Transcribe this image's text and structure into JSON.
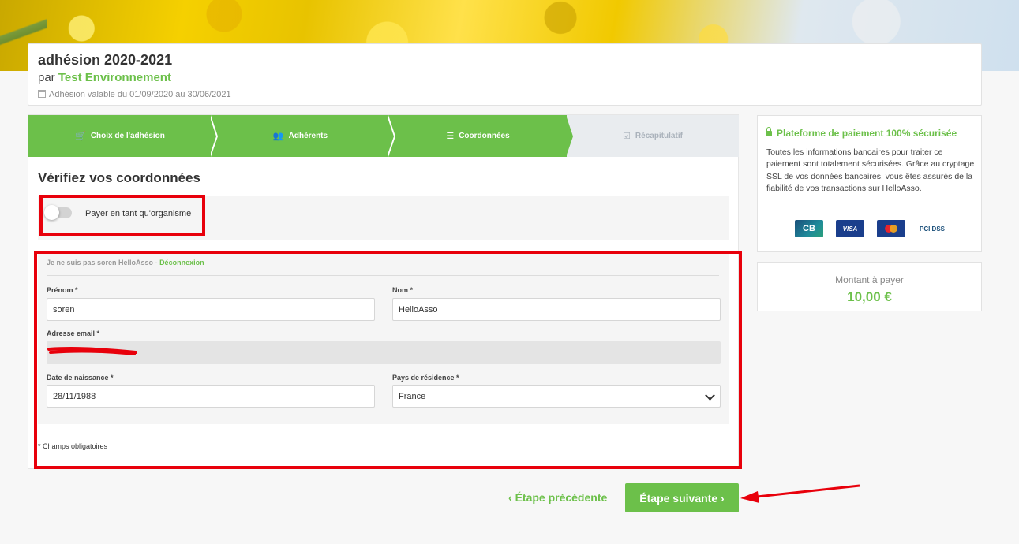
{
  "header": {
    "title": "adhésion 2020-2021",
    "by_prefix": "par",
    "organization": "Test Environnement",
    "validity": "Adhésion valable du 01/09/2020 au 30/06/2021"
  },
  "steps": [
    {
      "label": "Choix de l'adhésion",
      "icon": "cart-icon",
      "state": "done"
    },
    {
      "label": "Adhérents",
      "icon": "users-icon",
      "state": "done"
    },
    {
      "label": "Coordonnées",
      "icon": "list-icon",
      "state": "done"
    },
    {
      "label": "Récapitulatif",
      "icon": "check-square-icon",
      "state": "todo"
    }
  ],
  "form": {
    "section_title": "Vérifiez vos coordonnées",
    "org_toggle_label": "Payer en tant qu'organisme",
    "org_toggle_on": false,
    "not_me_text": "Je ne suis pas soren HelloAsso - ",
    "logout_link": "Déconnexion",
    "first_name_label": "Prénom *",
    "first_name_value": "soren",
    "last_name_label": "Nom *",
    "last_name_value": "HelloAsso",
    "email_label": "Adresse email *",
    "email_value": "",
    "birthdate_label": "Date de naissance *",
    "birthdate_value": "28/11/1988",
    "country_label": "Pays de résidence *",
    "country_value": "France",
    "required_note": "* Champs obligatoires"
  },
  "secure": {
    "title": "Plateforme de paiement 100% sécurisée",
    "text": "Toutes les informations bancaires pour traiter ce paiement sont totalement sécurisées. Grâce au cryptage SSL de vos données bancaires, vous êtes assurés de la fiabilité de vos transactions sur HelloAsso.",
    "cards": [
      {
        "name": "cb-card-icon",
        "text": "CB"
      },
      {
        "name": "visa-card-icon",
        "text": "VISA"
      },
      {
        "name": "mastercard-card-icon",
        "text": ""
      },
      {
        "name": "pci-dss-icon",
        "text": "PCI DSS"
      }
    ]
  },
  "amount": {
    "label": "Montant à payer",
    "value": "10,00 €"
  },
  "nav": {
    "prev_label": "Étape précédente",
    "next_label": "Étape suivante"
  },
  "colors": {
    "accent": "#6cc04a",
    "annotation": "#e8000b",
    "step_inactive": "#e9ecef"
  }
}
